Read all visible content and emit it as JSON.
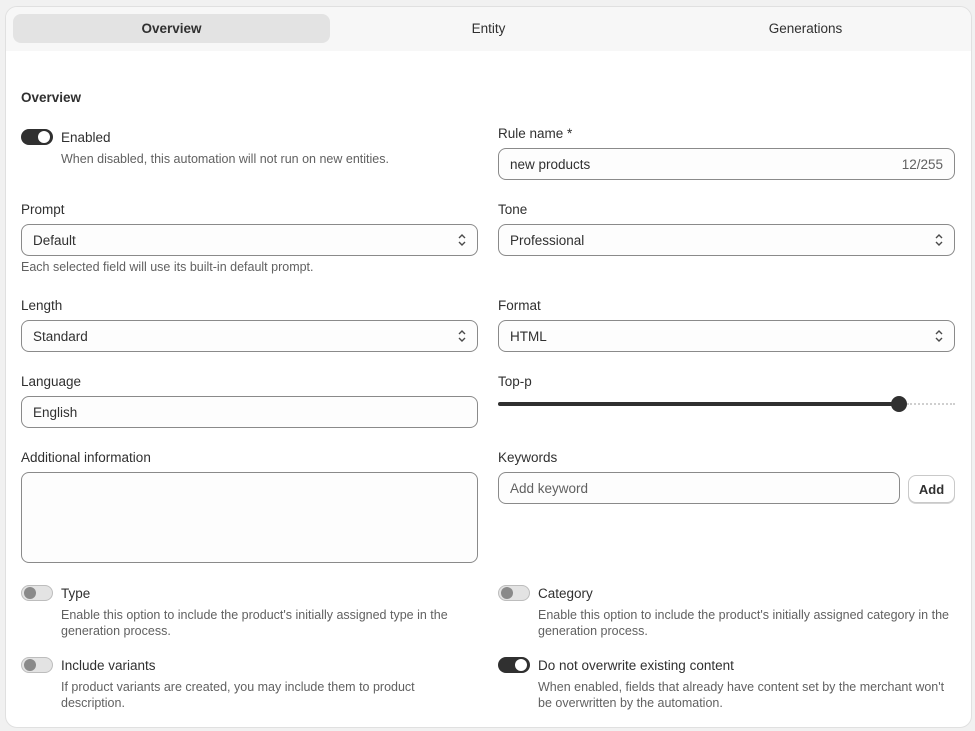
{
  "tabs": [
    {
      "label": "Overview",
      "active": true
    },
    {
      "label": "Entity",
      "active": false
    },
    {
      "label": "Generations",
      "active": false
    }
  ],
  "section_title": "Overview",
  "enabled": {
    "label": "Enabled",
    "state": "on",
    "help": "When disabled, this automation will not run on new entities."
  },
  "rule_name": {
    "label": "Rule name *",
    "value": "new products",
    "counter": "12/255"
  },
  "prompt": {
    "label": "Prompt",
    "value": "Default",
    "help": "Each selected field will use its built-in default prompt."
  },
  "tone": {
    "label": "Tone",
    "value": "Professional"
  },
  "length": {
    "label": "Length",
    "value": "Standard"
  },
  "format": {
    "label": "Format",
    "value": "HTML"
  },
  "language": {
    "label": "Language",
    "value": "English"
  },
  "top_p": {
    "label": "Top-p",
    "fraction": 0.878
  },
  "additional_info": {
    "label": "Additional information",
    "value": ""
  },
  "keywords": {
    "label": "Keywords",
    "placeholder": "Add keyword",
    "add_label": "Add"
  },
  "type_toggle": {
    "label": "Type",
    "state": "off",
    "help": "Enable this option to include the product's initially assigned type in the generation process."
  },
  "category_toggle": {
    "label": "Category",
    "state": "off",
    "help": "Enable this option to include the product's initially assigned category in the generation process."
  },
  "variants_toggle": {
    "label": "Include variants",
    "state": "off",
    "help": "If product variants are created, you may include them to product description."
  },
  "overwrite_toggle": {
    "label": "Do not overwrite existing content",
    "state": "on",
    "help": "When enabled, fields that already have content set by the merchant won't be overwritten by the automation."
  },
  "colors": {
    "accent": "#303030",
    "help_text": "#616161",
    "border": "#8a8a8a"
  }
}
